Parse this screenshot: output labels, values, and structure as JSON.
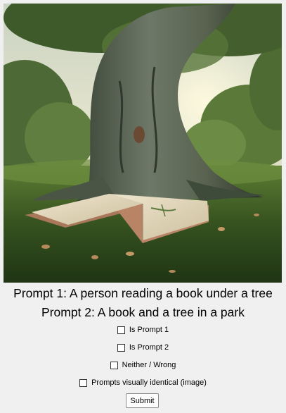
{
  "image": {
    "alt_icon": "tree-and-book-image"
  },
  "prompts": {
    "prompt1": "Prompt 1: A person reading a book under a tree",
    "prompt2": "Prompt 2: A book and a tree in a park"
  },
  "options": [
    {
      "label": "Is Prompt 1",
      "checked": false
    },
    {
      "label": "Is Prompt 2",
      "checked": false
    },
    {
      "label": "Neither / Wrong",
      "checked": false
    },
    {
      "label": "Prompts visually identical (image)",
      "checked": false
    }
  ],
  "submit_label": "Submit"
}
